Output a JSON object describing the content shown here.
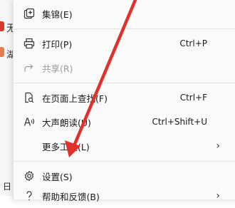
{
  "background": {
    "text_a": "无",
    "text_b": "湖",
    "text_c": "日"
  },
  "menu": {
    "items": [
      {
        "key": "collections",
        "label": "集锦(E)",
        "icon": "collections-icon"
      },
      {
        "key": "print",
        "label": "打印(P)",
        "shortcut": "Ctrl+P",
        "icon": "print-icon"
      },
      {
        "key": "share",
        "label": "共享(R)",
        "icon": "share-icon",
        "disabled": true
      },
      {
        "key": "find",
        "label": "在页面上查找(F)",
        "shortcut": "Ctrl+F",
        "icon": "find-icon"
      },
      {
        "key": "read-aloud",
        "label": "大声朗读(U)",
        "shortcut": "Ctrl+Shift+U",
        "icon": "read-aloud-icon"
      },
      {
        "key": "more-tools",
        "label": "更多工具(L)",
        "submenu": true
      },
      {
        "key": "settings",
        "label": "设置(S)",
        "icon": "gear-icon"
      },
      {
        "key": "help",
        "label": "帮助和反馈(B)",
        "submenu": true,
        "icon": "question-icon"
      }
    ],
    "submenu_arrow": "›"
  },
  "colors": {
    "annotation_arrow": "#e0322d"
  }
}
